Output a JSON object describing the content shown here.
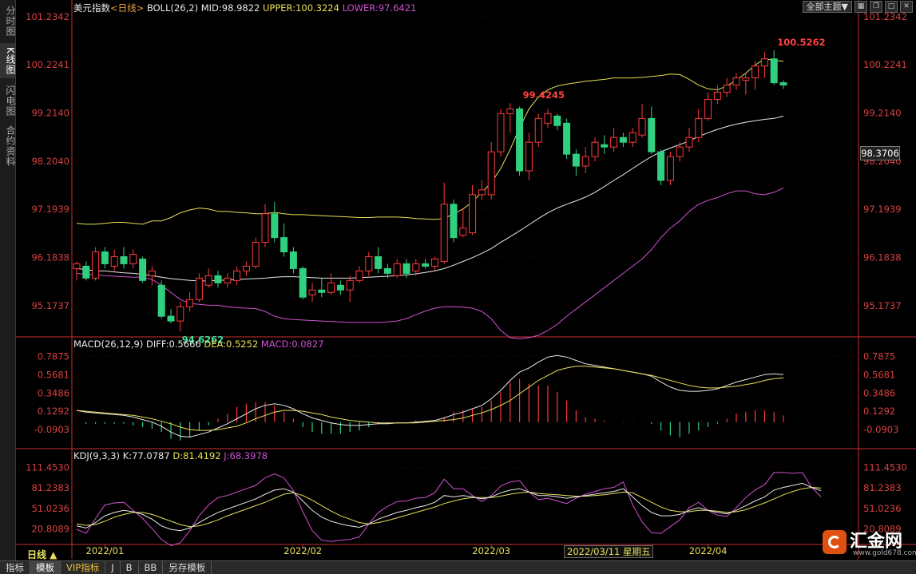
{
  "sidebar": {
    "tabs": [
      "分时图",
      "K线图",
      "闪电图",
      "合约资料"
    ],
    "active": 1
  },
  "header": {
    "main": {
      "name": "美元指数",
      "period": "<日线>",
      "indicator": "BOLL(26,2)",
      "mid": "MID:98.9822",
      "upper": "UPPER:100.3224",
      "lower": "LOWER:97.6421"
    },
    "macd": {
      "name": "MACD(26,12,9)",
      "diff": "DIFF:0.5666",
      "dea": "DEA:0.5252",
      "macd": "MACD:0.0827"
    },
    "kdj": {
      "name": "KDJ(9,3,3)",
      "k": "K:77.0787",
      "d": "D:81.4192",
      "j": "J:68.3978"
    }
  },
  "toolbar": {
    "theme_select": "全部主题▼",
    "icons": [
      "grid-icon",
      "restore-icon",
      "maximize-icon",
      "close-icon"
    ]
  },
  "current_price": "98.3706",
  "period_label": "日线 ▲",
  "crosshair_date": "2022/03/11 星期五",
  "bottom_tabs": [
    "指标",
    "模板",
    "VIP指标",
    "J",
    "B",
    "BB",
    "另存模板"
  ],
  "logo": {
    "text": "汇金网",
    "url": "www.gold678.com"
  },
  "colors": {
    "up": "#ff3a3a",
    "down": "#30d080",
    "mid": "#e8e8e8",
    "upper": "#e8e05a",
    "lower": "#d050d0",
    "axis": "#c83030",
    "grid": "#3a0000"
  },
  "chart_data": [
    {
      "type": "candlestick",
      "title": "美元指数 <日线>",
      "y_ticks": [
        "101.2342",
        "100.2241",
        "99.2140",
        "98.2040",
        "97.1939",
        "96.1838",
        "95.1737"
      ],
      "ylim": [
        94.55,
        101.3
      ],
      "x_ticks": [
        {
          "label": "2022/01",
          "index": 3
        },
        {
          "label": "2022/02",
          "index": 24
        },
        {
          "label": "2022/03",
          "index": 44
        },
        {
          "label": "2022/04",
          "index": 67
        }
      ],
      "annotations": [
        {
          "text": "100.5262",
          "index": 74,
          "value": 100.5262
        },
        {
          "text": "99.4245",
          "index": 47,
          "value": 99.4245
        },
        {
          "text": "94.6262",
          "index": 11,
          "value": 94.6262
        }
      ],
      "candles": [
        [
          95.95,
          96.05,
          95.7,
          96.1
        ],
        [
          96.0,
          95.75,
          95.7,
          96.1
        ],
        [
          95.75,
          96.3,
          95.7,
          96.4
        ],
        [
          96.3,
          96.05,
          95.95,
          96.4
        ],
        [
          96.0,
          96.2,
          95.9,
          96.35
        ],
        [
          96.2,
          96.05,
          95.95,
          96.4
        ],
        [
          96.05,
          96.25,
          95.95,
          96.35
        ],
        [
          96.15,
          95.7,
          95.65,
          96.2
        ],
        [
          95.8,
          95.9,
          95.6,
          96.0
        ],
        [
          95.6,
          94.95,
          94.9,
          95.7
        ],
        [
          94.95,
          94.85,
          94.8,
          95.1
        ],
        [
          94.85,
          95.15,
          94.63,
          95.25
        ],
        [
          95.15,
          95.3,
          95.05,
          95.45
        ],
        [
          95.3,
          95.75,
          95.25,
          95.85
        ],
        [
          95.6,
          95.8,
          95.55,
          95.95
        ],
        [
          95.8,
          95.65,
          95.55,
          95.9
        ],
        [
          95.65,
          95.75,
          95.55,
          95.85
        ],
        [
          95.7,
          95.9,
          95.6,
          96.0
        ],
        [
          95.9,
          96.0,
          95.8,
          96.1
        ],
        [
          96.0,
          96.5,
          95.95,
          96.6
        ],
        [
          96.5,
          97.1,
          96.4,
          97.3
        ],
        [
          97.1,
          96.6,
          96.5,
          97.35
        ],
        [
          96.6,
          96.3,
          96.2,
          96.9
        ],
        [
          96.3,
          95.95,
          95.85,
          96.4
        ],
        [
          95.95,
          95.35,
          95.3,
          96.0
        ],
        [
          95.4,
          95.5,
          95.25,
          95.65
        ],
        [
          95.5,
          95.45,
          95.35,
          95.75
        ],
        [
          95.45,
          95.65,
          95.4,
          95.85
        ],
        [
          95.6,
          95.5,
          95.4,
          95.7
        ],
        [
          95.5,
          95.7,
          95.25,
          95.8
        ],
        [
          95.7,
          95.9,
          95.65,
          96.0
        ],
        [
          95.9,
          96.2,
          95.8,
          96.3
        ],
        [
          96.2,
          95.95,
          95.85,
          96.4
        ],
        [
          95.95,
          95.85,
          95.75,
          96.05
        ],
        [
          95.8,
          96.05,
          95.75,
          96.15
        ],
        [
          96.05,
          95.85,
          95.75,
          96.15
        ],
        [
          95.9,
          96.05,
          95.8,
          96.15
        ],
        [
          96.05,
          96.0,
          95.95,
          96.15
        ],
        [
          96.0,
          96.15,
          95.9,
          96.2
        ],
        [
          96.1,
          97.3,
          96.05,
          97.75
        ],
        [
          97.3,
          96.6,
          96.5,
          97.4
        ],
        [
          96.65,
          96.8,
          96.6,
          97.2
        ],
        [
          96.7,
          97.5,
          96.65,
          97.7
        ],
        [
          97.5,
          97.6,
          97.4,
          97.8
        ],
        [
          97.5,
          98.4,
          97.4,
          98.6
        ],
        [
          98.4,
          99.2,
          98.3,
          99.3
        ],
        [
          99.2,
          99.3,
          98.8,
          99.42
        ],
        [
          99.3,
          98.0,
          97.9,
          99.35
        ],
        [
          98.0,
          98.6,
          97.8,
          98.8
        ],
        [
          98.6,
          99.1,
          98.5,
          99.2
        ],
        [
          99.0,
          99.2,
          98.9,
          99.3
        ],
        [
          99.15,
          98.95,
          98.85,
          99.2
        ],
        [
          99.0,
          98.35,
          98.25,
          99.1
        ],
        [
          98.35,
          98.1,
          97.9,
          98.45
        ],
        [
          98.1,
          98.3,
          97.95,
          98.5
        ],
        [
          98.3,
          98.6,
          98.2,
          98.7
        ],
        [
          98.55,
          98.5,
          98.35,
          98.75
        ],
        [
          98.5,
          98.7,
          98.4,
          98.9
        ],
        [
          98.7,
          98.6,
          98.5,
          98.8
        ],
        [
          98.6,
          98.8,
          98.5,
          98.9
        ],
        [
          98.75,
          99.1,
          98.7,
          99.4
        ],
        [
          99.1,
          98.4,
          98.35,
          99.35
        ],
        [
          98.4,
          97.8,
          97.7,
          98.45
        ],
        [
          97.8,
          98.3,
          97.7,
          98.4
        ],
        [
          98.3,
          98.5,
          98.2,
          98.6
        ],
        [
          98.5,
          98.7,
          98.4,
          98.9
        ],
        [
          98.7,
          99.1,
          98.6,
          99.3
        ],
        [
          99.1,
          99.5,
          99.05,
          99.65
        ],
        [
          99.5,
          99.65,
          99.4,
          99.8
        ],
        [
          99.65,
          99.8,
          99.55,
          99.95
        ],
        [
          99.8,
          99.95,
          99.7,
          100.05
        ],
        [
          99.9,
          99.95,
          99.6,
          100.05
        ],
        [
          99.95,
          100.2,
          99.7,
          100.3
        ],
        [
          100.2,
          100.35,
          99.95,
          100.5
        ],
        [
          100.35,
          99.85,
          99.8,
          100.53
        ],
        [
          99.85,
          99.8,
          99.72,
          99.9
        ]
      ],
      "boll_upper": [
        96.9,
        96.88,
        96.88,
        96.9,
        96.92,
        96.92,
        96.9,
        96.88,
        96.95,
        96.95,
        97.02,
        97.12,
        97.18,
        97.22,
        97.2,
        97.15,
        97.15,
        97.13,
        97.12,
        97.1,
        97.1,
        97.13,
        97.1,
        97.08,
        97.08,
        97.07,
        97.06,
        97.05,
        97.04,
        97.03,
        97.02,
        97.02,
        97.03,
        97.03,
        97.03,
        97.02,
        97.0,
        96.99,
        96.98,
        97.0,
        97.1,
        97.2,
        97.35,
        97.55,
        97.75,
        98.05,
        98.45,
        98.9,
        99.3,
        99.55,
        99.7,
        99.78,
        99.82,
        99.85,
        99.88,
        99.9,
        99.92,
        99.95,
        99.95,
        99.95,
        99.96,
        99.98,
        100.0,
        100.03,
        100.02,
        99.92,
        99.8,
        99.72,
        99.7,
        99.78,
        99.9,
        100.05,
        100.22,
        100.35,
        100.32,
        100.3
      ],
      "boll_mid": [
        95.95,
        95.93,
        95.9,
        95.9,
        95.88,
        95.86,
        95.85,
        95.83,
        95.8,
        95.77,
        95.74,
        95.72,
        95.7,
        95.69,
        95.69,
        95.7,
        95.71,
        95.72,
        95.73,
        95.74,
        95.75,
        95.77,
        95.78,
        95.78,
        95.77,
        95.76,
        95.75,
        95.75,
        95.75,
        95.75,
        95.76,
        95.77,
        95.78,
        95.79,
        95.8,
        95.82,
        95.84,
        95.87,
        95.9,
        95.95,
        96.02,
        96.1,
        96.18,
        96.27,
        96.37,
        96.5,
        96.62,
        96.74,
        96.87,
        97.0,
        97.12,
        97.22,
        97.3,
        97.37,
        97.45,
        97.55,
        97.67,
        97.8,
        97.92,
        98.05,
        98.18,
        98.3,
        98.4,
        98.48,
        98.55,
        98.63,
        98.72,
        98.8,
        98.87,
        98.93,
        98.98,
        99.02,
        99.05,
        99.08,
        99.1,
        99.15
      ],
      "boll_lower": [
        95.85,
        95.83,
        95.82,
        95.8,
        95.79,
        95.78,
        95.77,
        95.77,
        95.72,
        95.6,
        95.45,
        95.3,
        95.22,
        95.2,
        95.18,
        95.18,
        95.15,
        95.13,
        95.12,
        95.11,
        95.05,
        94.95,
        94.9,
        94.88,
        94.87,
        94.86,
        94.85,
        94.84,
        94.83,
        94.82,
        94.82,
        94.82,
        94.82,
        94.83,
        94.85,
        94.9,
        94.98,
        95.06,
        95.12,
        95.15,
        95.15,
        95.14,
        95.12,
        95.05,
        94.9,
        94.65,
        94.5,
        94.48,
        94.5,
        94.55,
        94.65,
        94.78,
        94.95,
        95.1,
        95.25,
        95.4,
        95.55,
        95.7,
        95.85,
        96.0,
        96.15,
        96.35,
        96.6,
        96.8,
        96.95,
        97.15,
        97.3,
        97.38,
        97.44,
        97.52,
        97.58,
        97.58,
        97.52,
        97.5,
        97.55,
        97.64
      ]
    },
    {
      "type": "macd",
      "title": "MACD(26,12,9)",
      "y_ticks": [
        "0.7875",
        "0.5681",
        "0.3486",
        "0.1292",
        "-0.0903"
      ],
      "ylim": [
        -0.3,
        0.85
      ],
      "diff": [
        0.14,
        0.12,
        0.11,
        0.1,
        0.09,
        0.08,
        0.06,
        0.03,
        0.0,
        -0.05,
        -0.12,
        -0.17,
        -0.18,
        -0.15,
        -0.12,
        -0.07,
        -0.02,
        0.04,
        0.1,
        0.16,
        0.2,
        0.22,
        0.2,
        0.16,
        0.1,
        0.05,
        0.02,
        -0.01,
        -0.03,
        -0.04,
        -0.04,
        -0.03,
        -0.02,
        -0.02,
        -0.01,
        -0.01,
        0.0,
        0.01,
        0.02,
        0.05,
        0.09,
        0.12,
        0.16,
        0.2,
        0.28,
        0.38,
        0.5,
        0.6,
        0.65,
        0.72,
        0.78,
        0.8,
        0.78,
        0.74,
        0.7,
        0.68,
        0.66,
        0.64,
        0.62,
        0.6,
        0.58,
        0.55,
        0.48,
        0.42,
        0.38,
        0.37,
        0.37,
        0.38,
        0.4,
        0.44,
        0.48,
        0.51,
        0.54,
        0.57,
        0.58,
        0.57
      ],
      "dea": [
        0.14,
        0.13,
        0.12,
        0.11,
        0.1,
        0.09,
        0.08,
        0.06,
        0.04,
        0.01,
        -0.02,
        -0.06,
        -0.09,
        -0.1,
        -0.1,
        -0.09,
        -0.07,
        -0.05,
        -0.01,
        0.04,
        0.08,
        0.12,
        0.14,
        0.14,
        0.13,
        0.11,
        0.09,
        0.06,
        0.04,
        0.02,
        0.01,
        0.0,
        -0.01,
        -0.01,
        -0.01,
        -0.01,
        -0.01,
        0.0,
        0.01,
        0.02,
        0.03,
        0.05,
        0.08,
        0.11,
        0.15,
        0.2,
        0.26,
        0.34,
        0.42,
        0.5,
        0.56,
        0.62,
        0.65,
        0.67,
        0.67,
        0.66,
        0.65,
        0.64,
        0.62,
        0.6,
        0.58,
        0.56,
        0.53,
        0.5,
        0.47,
        0.44,
        0.42,
        0.41,
        0.41,
        0.42,
        0.43,
        0.45,
        0.47,
        0.5,
        0.52,
        0.53
      ],
      "hist": [
        0.0,
        -0.02,
        -0.02,
        -0.02,
        -0.02,
        -0.02,
        -0.04,
        -0.06,
        -0.08,
        -0.12,
        -0.2,
        -0.22,
        -0.18,
        -0.1,
        -0.04,
        0.04,
        0.1,
        0.18,
        0.22,
        0.24,
        0.24,
        0.2,
        0.12,
        0.04,
        -0.06,
        -0.12,
        -0.14,
        -0.14,
        -0.14,
        -0.12,
        -0.1,
        -0.06,
        -0.02,
        -0.02,
        0.0,
        0.0,
        0.02,
        0.02,
        0.02,
        0.06,
        0.12,
        0.14,
        0.16,
        0.18,
        0.26,
        0.36,
        0.48,
        0.52,
        0.46,
        0.44,
        0.44,
        0.36,
        0.26,
        0.14,
        0.06,
        0.04,
        0.02,
        0.0,
        0.0,
        0.0,
        0.0,
        -0.02,
        -0.1,
        -0.16,
        -0.18,
        -0.14,
        -0.1,
        -0.06,
        -0.02,
        0.04,
        0.1,
        0.12,
        0.14,
        0.14,
        0.12,
        0.08
      ]
    },
    {
      "type": "kdj",
      "title": "KDJ(9,3,3)",
      "y_ticks": [
        "111.4530",
        "81.2383",
        "51.0236",
        "20.8089"
      ],
      "ylim": [
        0,
        118
      ],
      "k": [
        25,
        22,
        30,
        40,
        45,
        48,
        46,
        42,
        35,
        25,
        20,
        18,
        22,
        30,
        38,
        45,
        50,
        55,
        60,
        65,
        72,
        78,
        80,
        75,
        62,
        48,
        38,
        32,
        28,
        25,
        23,
        28,
        35,
        40,
        45,
        48,
        52,
        55,
        60,
        70,
        68,
        70,
        68,
        65,
        68,
        74,
        78,
        80,
        75,
        70,
        70,
        68,
        66,
        68,
        70,
        72,
        74,
        76,
        80,
        68,
        55,
        45,
        40,
        40,
        42,
        48,
        52,
        48,
        45,
        43,
        48,
        55,
        62,
        68,
        78,
        82,
        85,
        88,
        82,
        77
      ],
      "d": [
        28,
        26,
        27,
        32,
        38,
        42,
        45,
        45,
        42,
        37,
        32,
        27,
        24,
        25,
        29,
        34,
        40,
        45,
        50,
        55,
        60,
        66,
        72,
        74,
        70,
        63,
        55,
        47,
        40,
        35,
        30,
        28,
        30,
        33,
        37,
        41,
        45,
        49,
        53,
        58,
        62,
        65,
        67,
        67,
        67,
        69,
        72,
        74,
        75,
        73,
        72,
        71,
        70,
        69,
        69,
        70,
        71,
        73,
        75,
        74,
        67,
        60,
        53,
        48,
        46,
        46,
        48,
        48,
        47,
        45,
        46,
        49,
        54,
        59,
        65,
        71,
        76,
        80,
        82,
        81
      ],
      "j": [
        20,
        14,
        36,
        56,
        59,
        60,
        48,
        36,
        21,
        5,
        -4,
        0,
        18,
        40,
        56,
        67,
        70,
        75,
        80,
        85,
        96,
        102,
        96,
        77,
        46,
        18,
        4,
        2,
        4,
        5,
        9,
        28,
        45,
        54,
        61,
        62,
        66,
        67,
        74,
        94,
        80,
        80,
        70,
        61,
        70,
        84,
        90,
        92,
        75,
        64,
        66,
        62,
        58,
        66,
        72,
        76,
        80,
        82,
        90,
        56,
        31,
        15,
        14,
        24,
        34,
        52,
        60,
        48,
        41,
        39,
        52,
        67,
        78,
        86,
        104,
        104,
        103,
        104,
        82,
        68
      ]
    }
  ]
}
